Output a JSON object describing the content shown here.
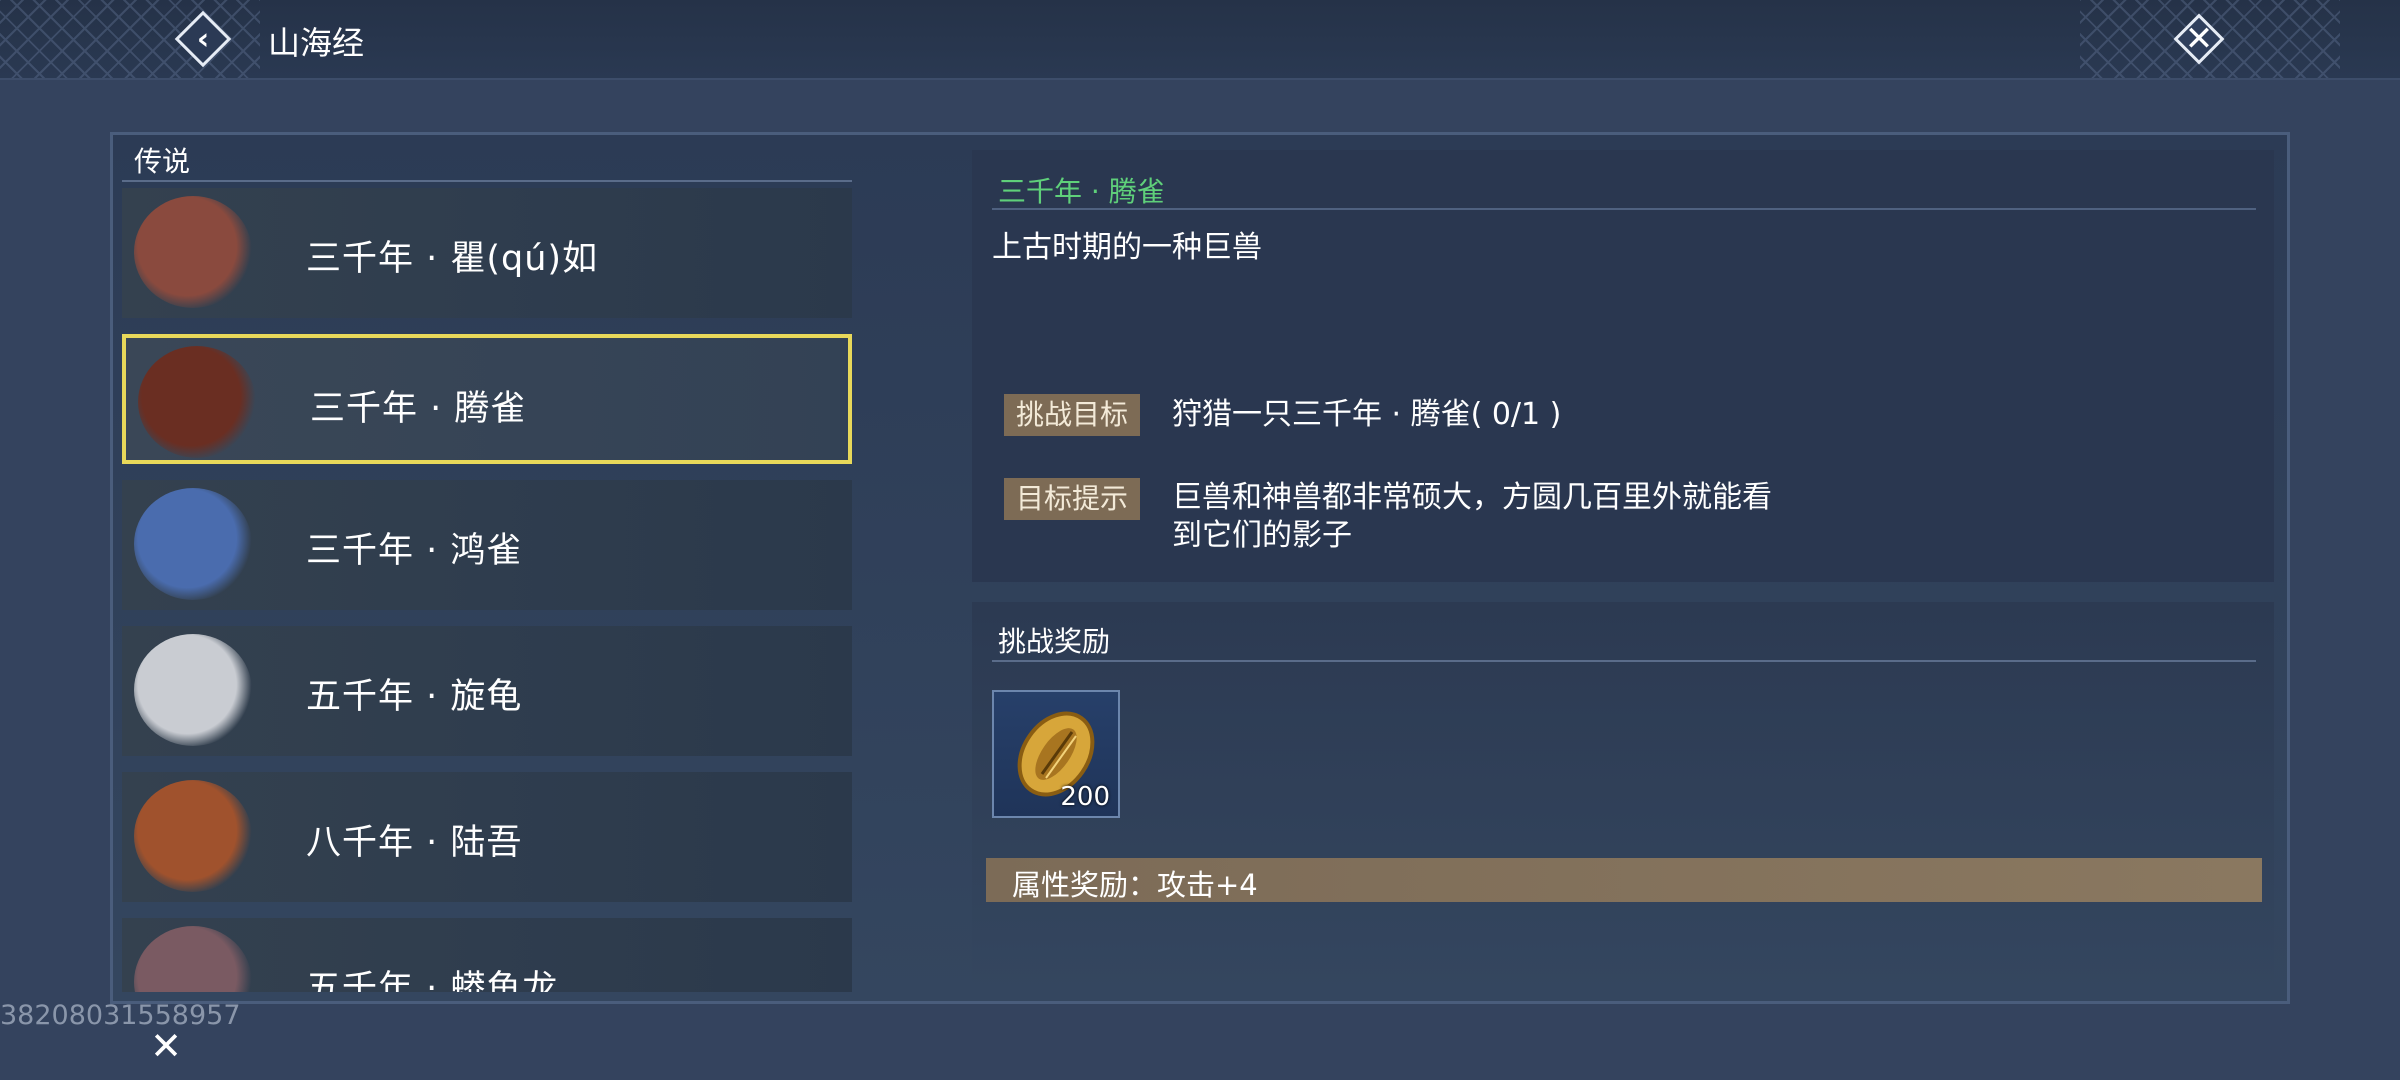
{
  "header": {
    "title": "山海经"
  },
  "list": {
    "section_label": "传说",
    "items": [
      {
        "label": "三千年 · 瞿(qú)如",
        "selected": false,
        "portrait_color": "#8a4a3e"
      },
      {
        "label": "三千年 · 腾雀",
        "selected": true,
        "portrait_color": "#6a2e22"
      },
      {
        "label": "三千年 · 鸿雀",
        "selected": false,
        "portrait_color": "#4a6cae"
      },
      {
        "label": "五千年 · 旋龟",
        "selected": false,
        "portrait_color": "#c9ccd2"
      },
      {
        "label": "八千年 · 陆吾",
        "selected": false,
        "portrait_color": "#a0522d"
      },
      {
        "label": "五千年 · 蟒鱼龙",
        "selected": false,
        "portrait_color": "#7a5a62"
      }
    ]
  },
  "detail": {
    "title": "三千年 · 腾雀",
    "description": "上古时期的一种巨兽",
    "goal_tag": "挑战目标",
    "goal_text": "狩猎一只三千年 · 腾雀( 0/1 )",
    "hint_tag": "目标提示",
    "hint_line1": "巨兽和神兽都非常硕大，方圆几百里外就能看",
    "hint_line2": "到它们的影子"
  },
  "reward": {
    "title": "挑战奖励",
    "item_quantity": "200",
    "item_icon": "gold-shell-icon",
    "attribute": "属性奖励：攻击+4"
  },
  "footer": {
    "uid": "38208031558957"
  },
  "colors": {
    "selected_border": "#e8d85a",
    "title_green": "#5fd07a",
    "tag_bg": "#7d6b55"
  }
}
